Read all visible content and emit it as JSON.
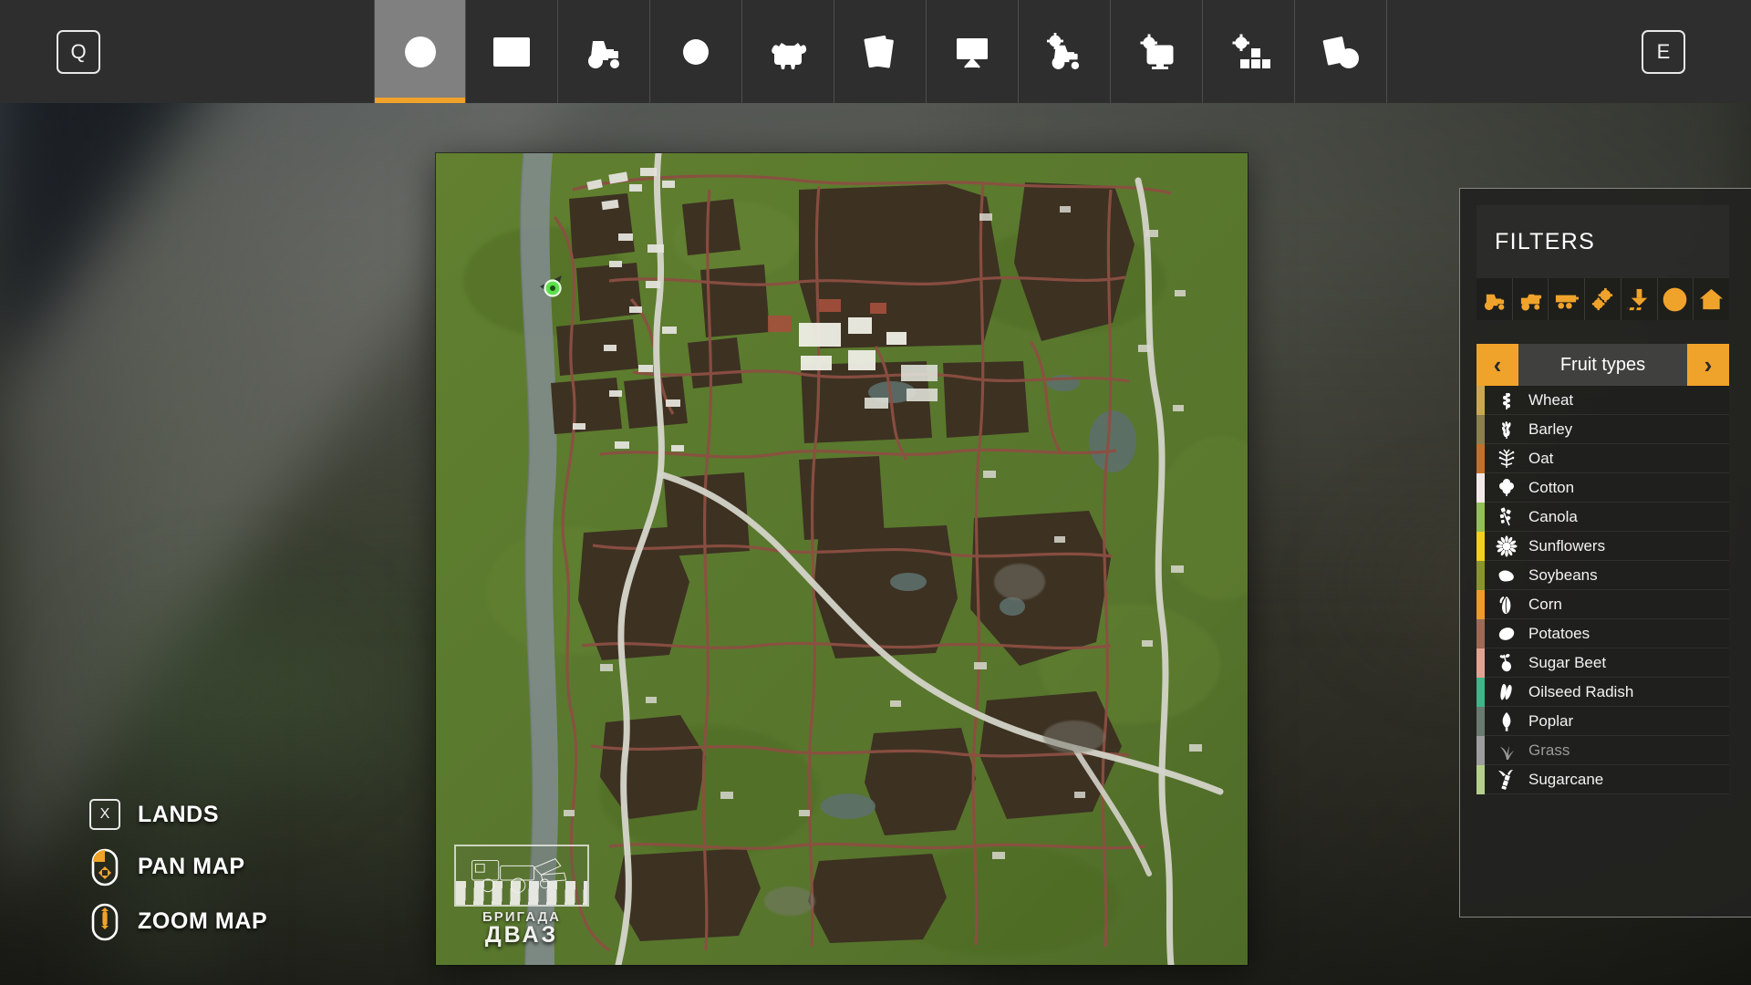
{
  "topbar": {
    "left_key": "Q",
    "right_key": "E",
    "tabs": [
      {
        "icon": "globe-icon",
        "label": "Map",
        "active": true
      },
      {
        "icon": "bar-chart-icon",
        "label": "Statistics",
        "active": false
      },
      {
        "icon": "tractor-icon",
        "label": "Vehicles",
        "active": false
      },
      {
        "icon": "dollar-coin-icon",
        "label": "Finances",
        "active": false
      },
      {
        "icon": "cow-icon",
        "label": "Animals",
        "active": false
      },
      {
        "icon": "contracts-icon",
        "label": "Contracts",
        "active": false
      },
      {
        "icon": "presentation-icon",
        "label": "Production",
        "active": false
      },
      {
        "icon": "tractor-gear-icon",
        "label": "Vehicle Settings",
        "active": false
      },
      {
        "icon": "monitor-gear-icon",
        "label": "Game Settings",
        "active": false
      },
      {
        "icon": "blocks-gear-icon",
        "label": "General Settings",
        "active": false
      },
      {
        "icon": "document-info-icon",
        "label": "Help",
        "active": false
      }
    ]
  },
  "help": [
    {
      "type": "key",
      "key": "X",
      "label": "LANDS"
    },
    {
      "type": "mouse",
      "icon": "mouse-pan-icon",
      "label": "PAN MAP"
    },
    {
      "type": "mouse",
      "icon": "mouse-zoom-icon",
      "label": "ZOOM MAP"
    }
  ],
  "filters": {
    "title": "FILTERS",
    "icons": [
      {
        "name": "tractor-filter-icon",
        "label": "Tractors"
      },
      {
        "name": "harvester-filter-icon",
        "label": "Harvesters"
      },
      {
        "name": "trailer-filter-icon",
        "label": "Trailers"
      },
      {
        "name": "tools-filter-icon",
        "label": "Tools"
      },
      {
        "name": "unload-filter-icon",
        "label": "Unloading points"
      },
      {
        "name": "warning-filter-icon",
        "label": "Warnings"
      },
      {
        "name": "house-filter-icon",
        "label": "Buildings"
      }
    ],
    "category": {
      "name": "Fruit types",
      "prev_label": "‹",
      "next_label": "›"
    },
    "fruits": [
      {
        "name": "Wheat",
        "icon": "wheat-icon",
        "color": "#c9a850",
        "enabled": true
      },
      {
        "name": "Barley",
        "icon": "barley-icon",
        "color": "#8c7f4e",
        "enabled": true
      },
      {
        "name": "Oat",
        "icon": "oat-icon",
        "color": "#c2712a",
        "enabled": true
      },
      {
        "name": "Cotton",
        "icon": "cotton-icon",
        "color": "#f3e9e6",
        "enabled": true
      },
      {
        "name": "Canola",
        "icon": "canola-icon",
        "color": "#93c055",
        "enabled": true
      },
      {
        "name": "Sunflowers",
        "icon": "sunflower-icon",
        "color": "#f2d01c",
        "enabled": true
      },
      {
        "name": "Soybeans",
        "icon": "soybean-icon",
        "color": "#8a942c",
        "enabled": true
      },
      {
        "name": "Corn",
        "icon": "corn-icon",
        "color": "#ef9a2a",
        "enabled": true
      },
      {
        "name": "Potatoes",
        "icon": "potato-icon",
        "color": "#9e6a55",
        "enabled": true
      },
      {
        "name": "Sugar Beet",
        "icon": "sugarbeet-icon",
        "color": "#e2a392",
        "enabled": true
      },
      {
        "name": "Oilseed Radish",
        "icon": "oilseedradish-icon",
        "color": "#3fb58a",
        "enabled": true
      },
      {
        "name": "Poplar",
        "icon": "poplar-icon",
        "color": "#6b7a70",
        "enabled": true
      },
      {
        "name": "Grass",
        "icon": "grass-icon",
        "color": "#9d9d9d",
        "enabled": false
      },
      {
        "name": "Sugarcane",
        "icon": "sugarcane-icon",
        "color": "#b5d08a",
        "enabled": true
      }
    ]
  },
  "map_logo": {
    "line1": "БРИГАДА",
    "line2": "ДВАЗ",
    "vehicle_icon": "combine-harvester-icon"
  },
  "map": {
    "player_marker_color": "#5ce04b",
    "field_color": "#3b2f22",
    "grass_color": "#5d7a34",
    "road_color": "#8c4f42",
    "paved_road_color": "#d6d6cc",
    "water_color": "#7f8b8a"
  },
  "theme": {
    "accent": "#f0a32a",
    "topbar_bg": "#2e2e2e",
    "active_tab_bg": "#808080",
    "panel_bg": "#222220",
    "text": "#ffffff"
  }
}
